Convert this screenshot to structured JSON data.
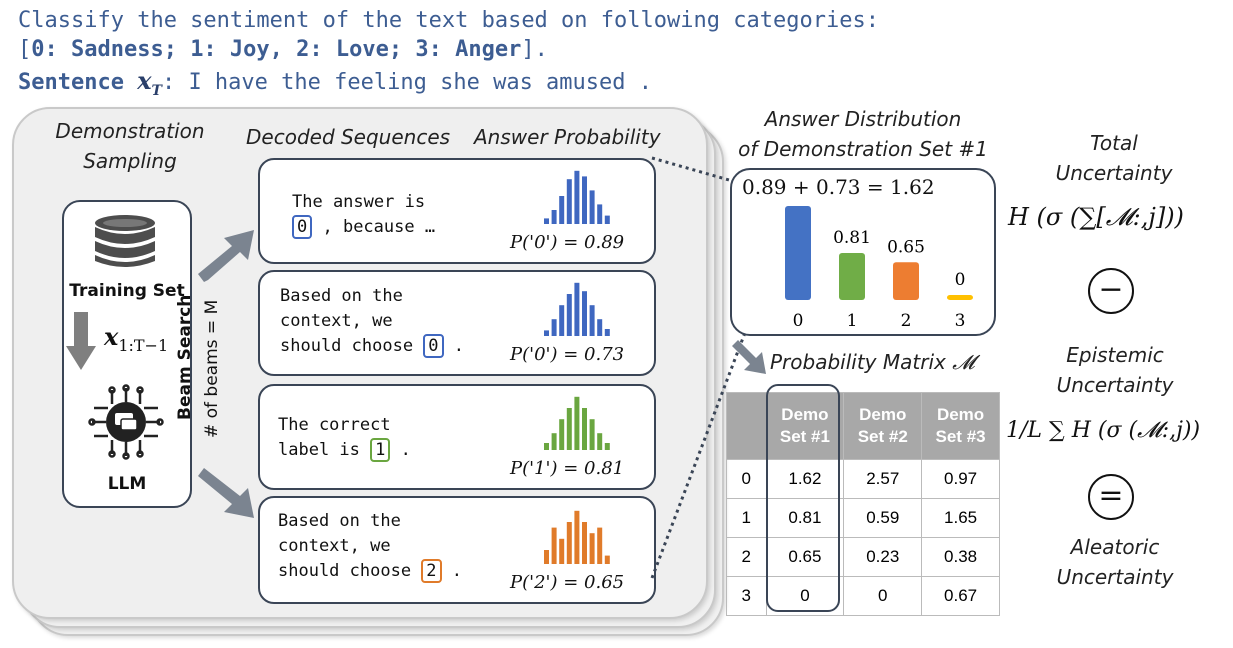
{
  "prompt": {
    "line1": "Classify the sentiment of the text based on following categories:",
    "line2_open": "[",
    "line2_cats": "0: Sadness; 1: Joy, 2: Love; 3: Anger",
    "line2_close": "].",
    "sentence_label": "Sentence",
    "sentence_var": "x",
    "sentence_sub": "T",
    "sentence_text": ": I have the feeling she was amused ."
  },
  "headers": {
    "demo_sampling_1": "Demonstration",
    "demo_sampling_2": "Sampling",
    "decoded": "Decoded Sequences",
    "answer_prob": "Answer Probability"
  },
  "left": {
    "training_set": "Training Set",
    "x_var": "x",
    "x_sub": "1:T−1",
    "llm": "LLM",
    "beam_search": "Beam Search",
    "beams": "# of beams = M"
  },
  "sequences": [
    {
      "pre": "The answer is\n",
      "token": "0",
      "post": " , because …",
      "color": "#3f67c0",
      "prob_label": "P('0') = 0.89",
      "bars": [
        4,
        10,
        20,
        32,
        38,
        34,
        24,
        14,
        6
      ]
    },
    {
      "pre": "Based on the\ncontext, we\nshould choose ",
      "token": "0",
      "post": " .",
      "color": "#3f67c0",
      "prob_label": "P('0') = 0.73",
      "bars": [
        4,
        12,
        22,
        30,
        38,
        32,
        22,
        12,
        5
      ]
    },
    {
      "pre": "The correct\nlabel is ",
      "token": "1",
      "post": " .",
      "color": "#6aa640",
      "prob_label": "P('1') = 0.81",
      "bars": [
        5,
        12,
        22,
        30,
        38,
        30,
        22,
        12,
        5
      ]
    },
    {
      "pre": "Based on the\ncontext, we\nshould choose ",
      "token": "2",
      "post": " .",
      "color": "#e07b2a",
      "prob_label": "P('2') = 0.65",
      "bars": [
        10,
        26,
        18,
        30,
        38,
        30,
        22,
        26,
        6
      ]
    }
  ],
  "answer_dist": {
    "title1": "Answer Distribution",
    "title2": "of Demonstration Set #1",
    "equation": "0.89 + 0.73 = 1.62",
    "bars": [
      {
        "label": "0",
        "value": 1.62,
        "value_label": "",
        "color": "#4472c4"
      },
      {
        "label": "1",
        "value": 0.81,
        "value_label": "0.81",
        "color": "#70ad47"
      },
      {
        "label": "2",
        "value": 0.65,
        "value_label": "0.65",
        "color": "#ed7d31"
      },
      {
        "label": "3",
        "value": 0,
        "value_label": "0",
        "color": "#ffc000"
      }
    ]
  },
  "matrix": {
    "title": "Probability Matrix",
    "symbol": "𝓜",
    "headers": [
      "",
      "Demo\nSet #1",
      "Demo\nSet #2",
      "Demo\nSet #3"
    ],
    "rows": [
      [
        "0",
        "1.62",
        "2.57",
        "0.97"
      ],
      [
        "1",
        "0.81",
        "0.59",
        "1.65"
      ],
      [
        "2",
        "0.65",
        "0.23",
        "0.38"
      ],
      [
        "3",
        "0",
        "0",
        "0.67"
      ]
    ]
  },
  "uncertainty": {
    "total1": "Total",
    "total2": "Uncertainty",
    "total_formula": "H (σ (∑[𝓜:,j]))",
    "minus": "−",
    "epistemic1": "Epistemic",
    "epistemic2": "Uncertainty",
    "epistemic_formula": "1/L ∑ H (σ (𝓜:,j))",
    "equals": "=",
    "aleatoric1": "Aleatoric",
    "aleatoric2": "Uncertainty"
  }
}
